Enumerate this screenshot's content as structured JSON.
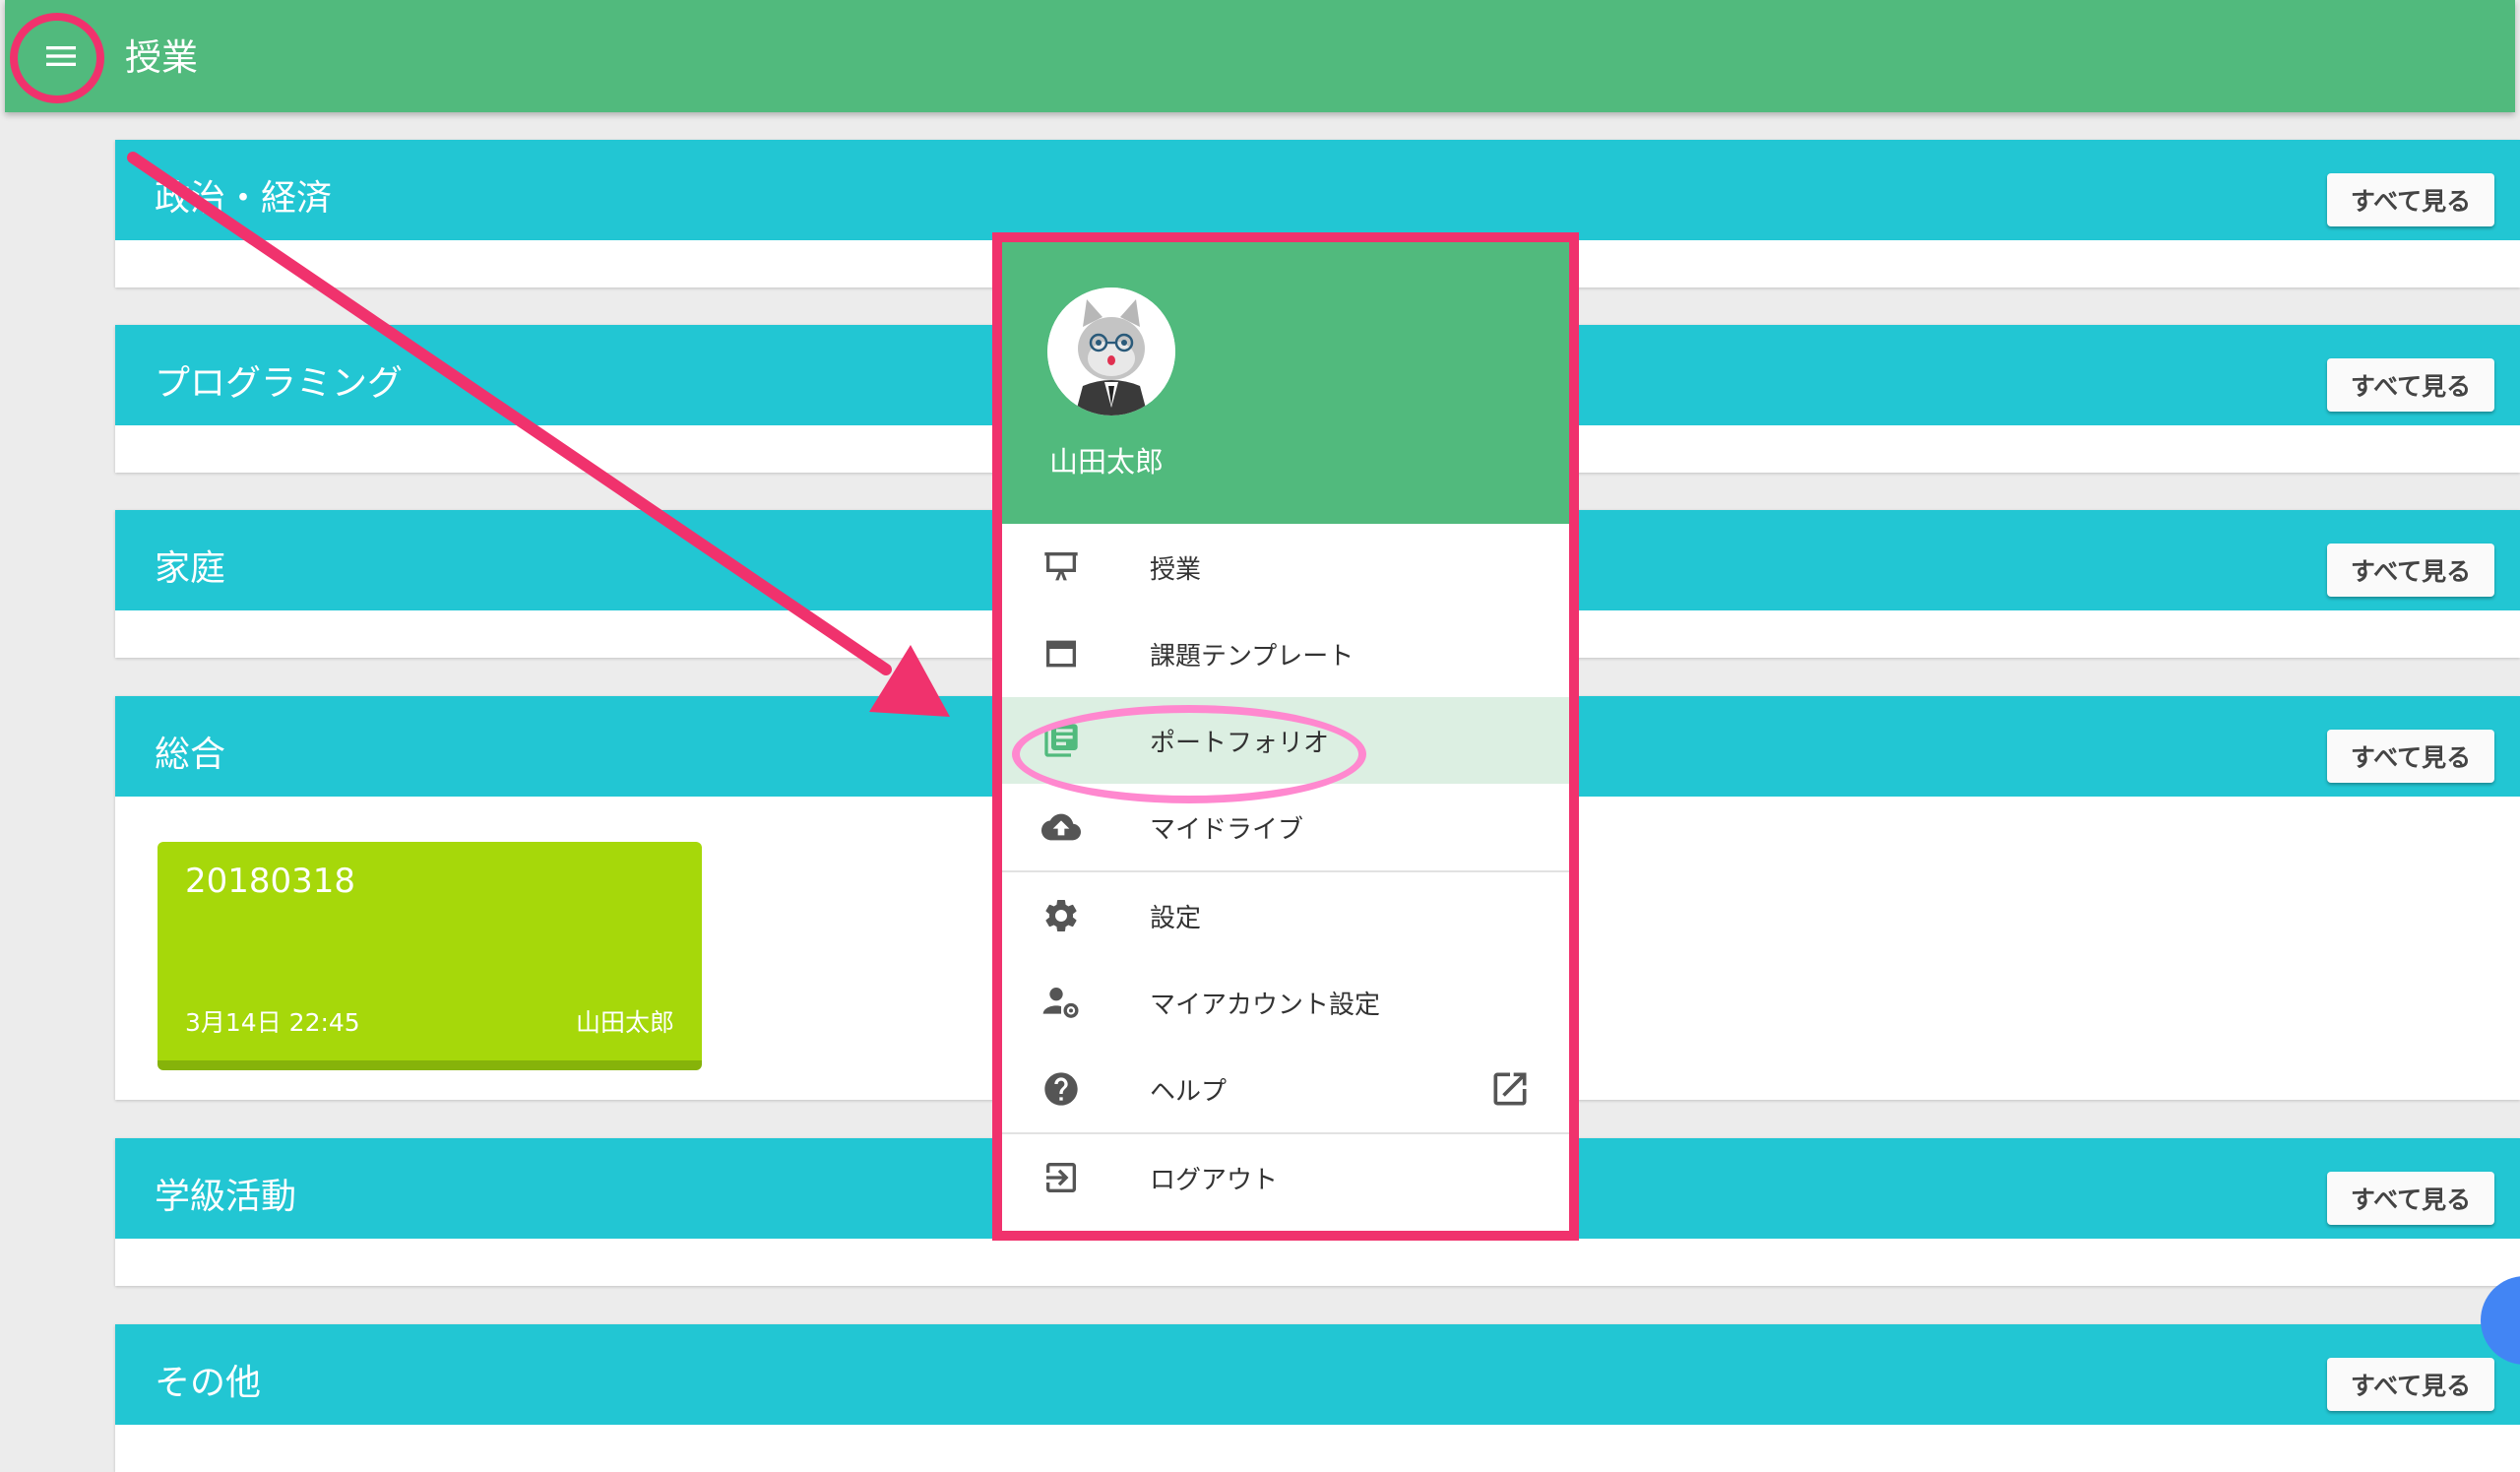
{
  "topbar": {
    "title": "授業",
    "menu_icon": "menu-icon"
  },
  "sections": [
    {
      "title": "政治・経済",
      "button": "すべて見る"
    },
    {
      "title": "プログラミング",
      "button": "すべて見る"
    },
    {
      "title": "家庭",
      "button": "すべて見る"
    },
    {
      "title": "総合",
      "button": "すべて見る"
    },
    {
      "title": "学級活動",
      "button": "すべて見る"
    },
    {
      "title": "その他",
      "button": "すべて見る"
    }
  ],
  "card": {
    "title": "20180318",
    "date": "3月14日 22:45",
    "author": "山田太郎"
  },
  "drawer": {
    "user_name": "山田太郎",
    "items": [
      {
        "label": "授業",
        "icon": "presentation-icon"
      },
      {
        "label": "課題テンプレート",
        "icon": "template-icon"
      },
      {
        "label": "ポートフォリオ",
        "icon": "library-books-icon"
      },
      {
        "label": "マイドライブ",
        "icon": "cloud-upload-icon"
      },
      {
        "label": "設定",
        "icon": "gear-icon"
      },
      {
        "label": "マイアカウント設定",
        "icon": "account-settings-icon"
      },
      {
        "label": "ヘルプ",
        "icon": "help-icon"
      },
      {
        "label": "ログアウト",
        "icon": "logout-icon"
      }
    ],
    "active_index": 2
  },
  "colors": {
    "topbar": "#51ba7d",
    "section_header": "#22c6d3",
    "card": "#a6d80a",
    "highlight_frame": "#f0326d",
    "highlight_oval": "#ff88cf",
    "active_item": "#dcefe2"
  }
}
